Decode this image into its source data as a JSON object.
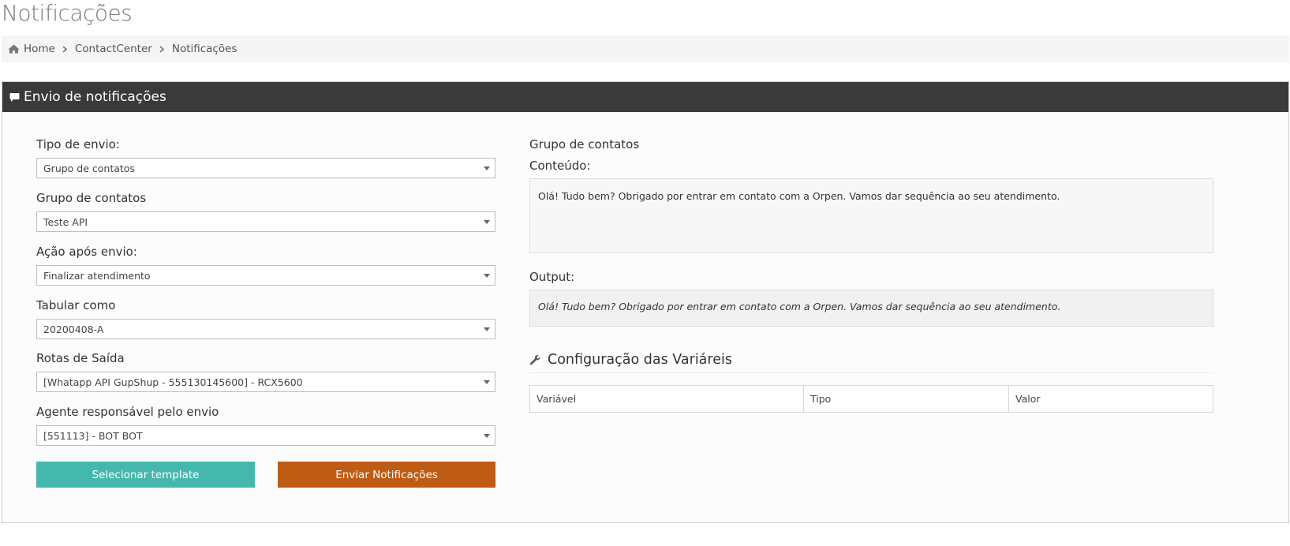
{
  "page": {
    "title": "Notificações"
  },
  "breadcrumb": {
    "home": "Home",
    "items": [
      "ContactCenter",
      "Notificações"
    ]
  },
  "panel": {
    "title": "Envio de notificações"
  },
  "form": {
    "tipo_envio": {
      "label": "Tipo de envio:",
      "value": "Grupo de contatos"
    },
    "grupo_contatos": {
      "label": "Grupo de contatos",
      "value": "Teste API"
    },
    "acao_apos_envio": {
      "label": "Ação após envio:",
      "value": "Finalizar atendimento"
    },
    "tabular_como": {
      "label": "Tabular como",
      "value": "20200408-A"
    },
    "rotas_saida": {
      "label": "Rotas de Saída",
      "value": "[Whatapp API GupShup - 555130145600] - RCX5600"
    },
    "agente": {
      "label": "Agente responsável pelo envio",
      "value": "[551113] - BOT BOT"
    }
  },
  "buttons": {
    "select_template": "Selecionar template",
    "send": "Enviar Notificações"
  },
  "right": {
    "group_label": "Grupo de contatos",
    "content_label": "Conteúdo:",
    "content_text": "Olá! Tudo bem? Obrigado por entrar em contato com a Orpen. Vamos dar sequência ao seu atendimento.",
    "output_label": "Output:",
    "output_text": "Olá! Tudo bem? Obrigado por entrar em contato com a Orpen. Vamos dar sequência ao seu atendimento."
  },
  "variables": {
    "title": "Configuração das Variáreis",
    "columns": [
      "Variável",
      "Tipo",
      "Valor"
    ]
  },
  "colors": {
    "header_bg": "#3a3a3a",
    "teal": "#45b8ad",
    "orange": "#bf5c14"
  },
  "icons": {
    "home": "home-icon",
    "breadcrumb_sep": "chevron-right-icon",
    "panel": "comment-icon",
    "config": "wrench-icon",
    "select_caret": "caret-down-icon"
  }
}
